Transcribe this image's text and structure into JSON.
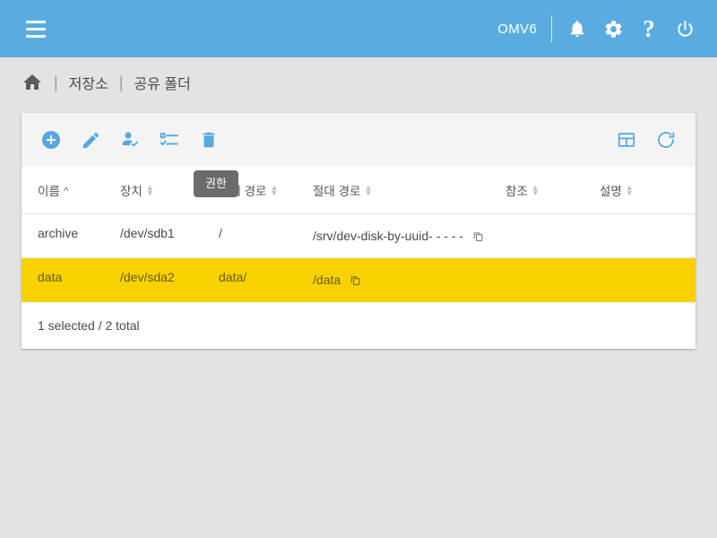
{
  "appbar": {
    "menu_icon": "hamburger-menu-icon",
    "brand": "OMV6",
    "icons": [
      {
        "name": "notifications-bell-icon",
        "label": "Notifications"
      },
      {
        "name": "settings-gear-icon",
        "label": "Settings"
      },
      {
        "name": "help-question-icon",
        "label": "Help"
      },
      {
        "name": "power-icon",
        "label": "Power"
      }
    ]
  },
  "breadcrumb": {
    "home_icon": "home-icon",
    "separator": "|",
    "items": [
      {
        "label": "저장소"
      },
      {
        "label": "공유 폴더"
      }
    ]
  },
  "toolbar": {
    "left": [
      {
        "name": "add-button",
        "icon": "plus-circle-icon"
      },
      {
        "name": "edit-button",
        "icon": "pencil-icon"
      },
      {
        "name": "privileges-button",
        "icon": "user-check-icon"
      },
      {
        "name": "acl-button",
        "icon": "list-check-icon"
      },
      {
        "name": "delete-button",
        "icon": "trash-icon"
      }
    ],
    "right": [
      {
        "name": "column-chooser-button",
        "icon": "table-grid-icon"
      },
      {
        "name": "reload-button",
        "icon": "refresh-icon"
      }
    ]
  },
  "tooltip": {
    "text": "권한",
    "visible": true
  },
  "table": {
    "columns": [
      {
        "label": "이름",
        "sort": "asc"
      },
      {
        "label": "장치",
        "sort": "none"
      },
      {
        "label": "상대 경로",
        "sort": "none"
      },
      {
        "label": "절대 경로",
        "sort": "none"
      },
      {
        "label": "참조",
        "sort": "none"
      },
      {
        "label": "설명",
        "sort": "none"
      }
    ],
    "rows": [
      {
        "name": "archive",
        "device": "/dev/sdb1",
        "relative_path": "/",
        "absolute_path": "/srv/dev-disk-by-uuid-       -     -      -       -",
        "reference": "",
        "description": "",
        "selected": false,
        "copy_icon": "copy-icon"
      },
      {
        "name": "data",
        "device": "/dev/sda2",
        "relative_path": "data/",
        "absolute_path": "/data",
        "reference": "",
        "description": "",
        "selected": true,
        "copy_icon": "copy-icon"
      }
    ]
  },
  "footer": {
    "status": "1 selected / 2 total"
  },
  "colors": {
    "appbar_blue": "#5aace0",
    "accent_blue": "#56a8dd",
    "selected_yellow": "#f7d200",
    "page_background": "#e3e3e5",
    "card_background": "#ffffff",
    "toolbar_background": "#f4f4f4",
    "tooltip_background": "#6b6b6b"
  }
}
